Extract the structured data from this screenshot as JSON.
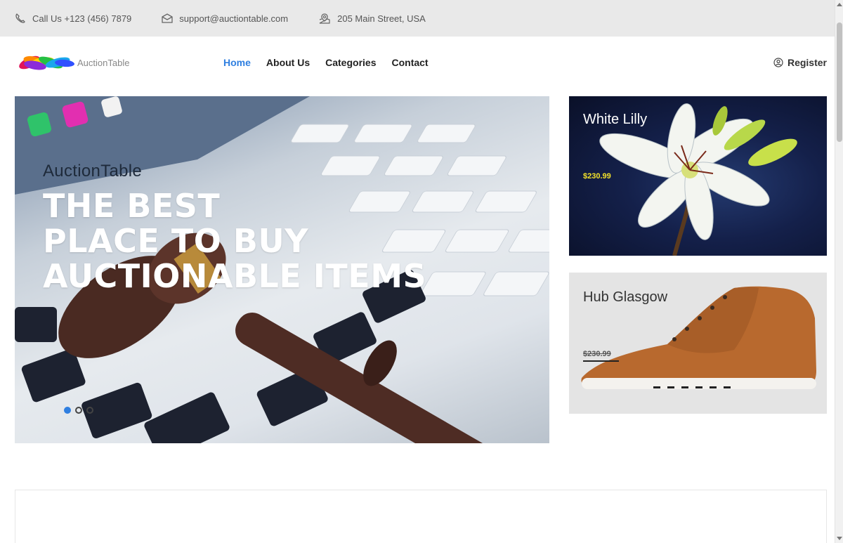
{
  "topbar": {
    "phone": "Call Us +123 (456) 7879",
    "email": "support@auctiontable.com",
    "address": "205 Main Street, USA"
  },
  "nav": {
    "brand": "AuctionTable",
    "items": [
      {
        "label": "Home",
        "active": true
      },
      {
        "label": "About Us",
        "active": false
      },
      {
        "label": "Categories",
        "active": false
      },
      {
        "label": "Contact",
        "active": false
      }
    ],
    "register": "Register"
  },
  "hero": {
    "kicker": "AuctionTable",
    "headline": [
      "THE BEST",
      "PLACE TO BUY",
      "AUCTIONABLE ITEMS"
    ],
    "slides": 3,
    "active_slide": 1
  },
  "cards": [
    {
      "title": "White Lilly",
      "price": "$230.99"
    },
    {
      "title": "Hub Glasgow",
      "price": "$230.99"
    }
  ],
  "colors": {
    "accent": "#2f7fe0",
    "topbar_bg": "#e9e9e9",
    "price_highlight": "#f3e22a"
  },
  "icons": [
    "phone-icon",
    "mail-icon",
    "location-icon",
    "user-circle-icon",
    "rainbow-logo"
  ]
}
